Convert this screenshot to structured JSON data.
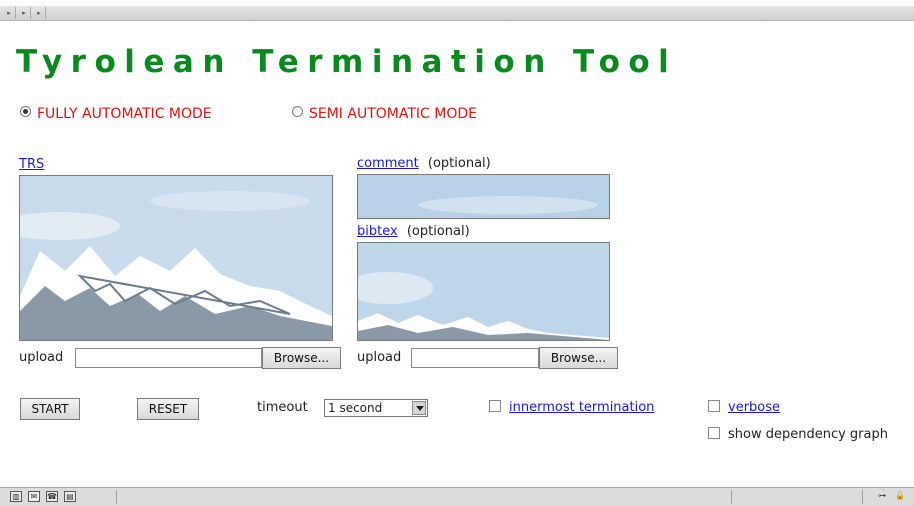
{
  "browser": {
    "tab_glyphs": [
      "▸",
      "▸",
      "▸"
    ]
  },
  "title": "Tyrolean Termination Tool",
  "modes": {
    "fully": "FULLY AUTOMATIC MODE",
    "semi": "SEMI AUTOMATIC MODE",
    "selected": "fully"
  },
  "trs": {
    "label": "TRS",
    "upload_label": "upload",
    "browse": "Browse..."
  },
  "comment": {
    "label": "comment",
    "note": "(optional)"
  },
  "bibtex": {
    "label": "bibtex",
    "note": "(optional)",
    "upload_label": "upload",
    "browse": "Browse..."
  },
  "actions": {
    "start": "START",
    "reset": "RESET"
  },
  "timeout": {
    "label": "timeout",
    "value": "1 second"
  },
  "options": {
    "innermost": {
      "label": "innermost termination",
      "checked": false
    },
    "verbose": {
      "label": "verbose",
      "checked": false
    },
    "dependency_graph": {
      "label": "show dependency graph",
      "checked": false
    }
  },
  "status_icons": [
    "navigator-icon",
    "mail-icon",
    "addressbook-icon",
    "composer-icon"
  ],
  "colors": {
    "title": "#0a8a1e",
    "mode_text": "#e01010",
    "link": "#1a1acc"
  }
}
